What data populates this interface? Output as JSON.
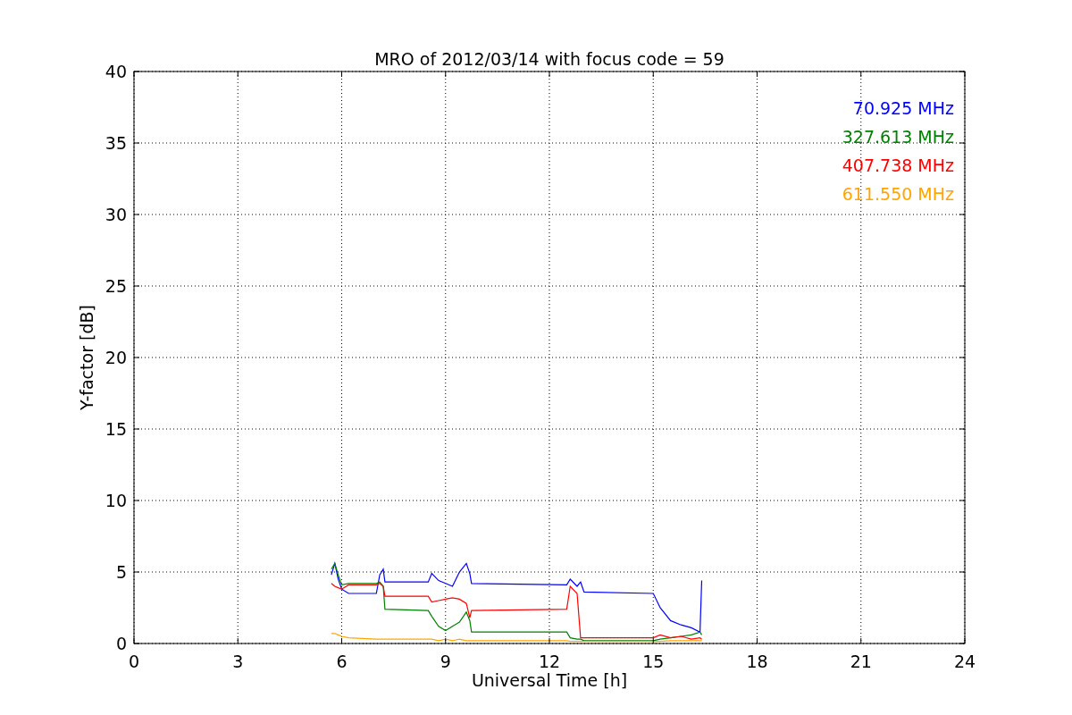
{
  "chart_data": {
    "type": "line",
    "title": "MRO of 2012/03/14 with focus code = 59",
    "xlabel": "Universal Time [h]",
    "ylabel": "Y-factor [dB]",
    "x": [
      5.7,
      5.8,
      5.9,
      6.0,
      6.2,
      7.0,
      7.1,
      7.2,
      7.25,
      8.5,
      8.6,
      8.8,
      9.0,
      9.2,
      9.4,
      9.6,
      9.7,
      9.75,
      12.5,
      12.6,
      12.8,
      12.9,
      13.0,
      15.0,
      15.2,
      15.5,
      15.8,
      16.1,
      16.35,
      16.4
    ],
    "series": [
      {
        "name": "70.925 MHz",
        "color": "#0000ff",
        "values": [
          4.8,
          5.6,
          4.5,
          3.8,
          3.5,
          3.5,
          4.8,
          5.2,
          4.3,
          4.3,
          4.9,
          4.4,
          4.2,
          4.0,
          5.0,
          5.6,
          4.9,
          4.2,
          4.1,
          4.5,
          4.0,
          4.3,
          3.6,
          3.5,
          2.5,
          1.6,
          1.3,
          1.1,
          0.8,
          4.4
        ]
      },
      {
        "name": "327.613 MHz",
        "color": "#008000",
        "values": [
          5.2,
          5.6,
          4.8,
          4.1,
          4.2,
          4.2,
          4.3,
          4.0,
          2.4,
          2.3,
          1.9,
          1.2,
          0.9,
          1.2,
          1.5,
          2.2,
          1.6,
          0.8,
          0.8,
          0.4,
          0.3,
          0.3,
          0.2,
          0.2,
          0.3,
          0.4,
          0.5,
          0.6,
          0.8,
          0.6
        ]
      },
      {
        "name": "407.738 MHz",
        "color": "#ff0000",
        "values": [
          4.2,
          4.0,
          3.9,
          3.8,
          4.1,
          4.1,
          4.2,
          4.0,
          3.3,
          3.3,
          2.9,
          3.0,
          3.1,
          3.2,
          3.1,
          2.8,
          1.8,
          2.3,
          2.4,
          4.0,
          3.5,
          0.4,
          0.4,
          0.4,
          0.6,
          0.4,
          0.5,
          0.3,
          0.4,
          0.3
        ]
      },
      {
        "name": "611.550 MHz",
        "color": "#ffa500",
        "values": [
          0.7,
          0.7,
          0.6,
          0.5,
          0.4,
          0.3,
          0.3,
          0.3,
          0.3,
          0.3,
          0.3,
          0.2,
          0.3,
          0.2,
          0.3,
          0.2,
          0.2,
          0.2,
          0.2,
          0.15,
          0.15,
          0.15,
          0.15,
          0.15,
          0.15,
          0.2,
          0.2,
          0.2,
          0.2,
          0.2
        ]
      }
    ],
    "xlim": [
      0,
      24
    ],
    "ylim": [
      0,
      40
    ],
    "xticks": [
      0,
      3,
      6,
      9,
      12,
      15,
      18,
      21,
      24
    ],
    "yticks": [
      0,
      5,
      10,
      15,
      20,
      25,
      30,
      35,
      40
    ],
    "grid": true
  }
}
